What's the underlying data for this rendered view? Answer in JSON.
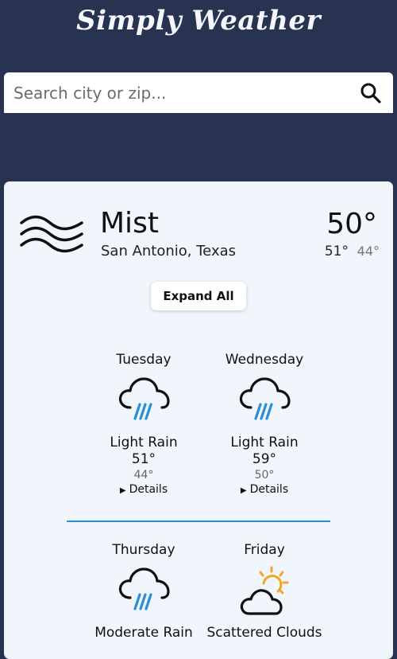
{
  "header": {
    "title": "Simply Weather"
  },
  "search": {
    "placeholder": "Search city or zip...",
    "icon": "search-icon"
  },
  "current": {
    "condition": "Mist",
    "icon": "mist-icon",
    "location": "San Antonio, Texas",
    "temp": "50°",
    "high": "51°",
    "low": "44°"
  },
  "controls": {
    "expand_all": "Expand All"
  },
  "forecast": [
    {
      "day": "Tuesday",
      "icon": "rain-cloud-icon",
      "condition": "Light Rain",
      "high": "51°",
      "low": "44°",
      "details": "Details"
    },
    {
      "day": "Wednesday",
      "icon": "rain-cloud-icon",
      "condition": "Light Rain",
      "high": "59°",
      "low": "50°",
      "details": "Details"
    },
    {
      "day": "Thursday",
      "icon": "rain-cloud-icon",
      "condition": "Moderate Rain"
    },
    {
      "day": "Friday",
      "icon": "partly-cloudy-icon",
      "condition": "Scattered Clouds"
    }
  ],
  "colors": {
    "background": "#283251",
    "card": "#f0f6fc",
    "rain": "#2b8fd6",
    "sun": "#f5a623",
    "divider": "#2b8fd6"
  }
}
